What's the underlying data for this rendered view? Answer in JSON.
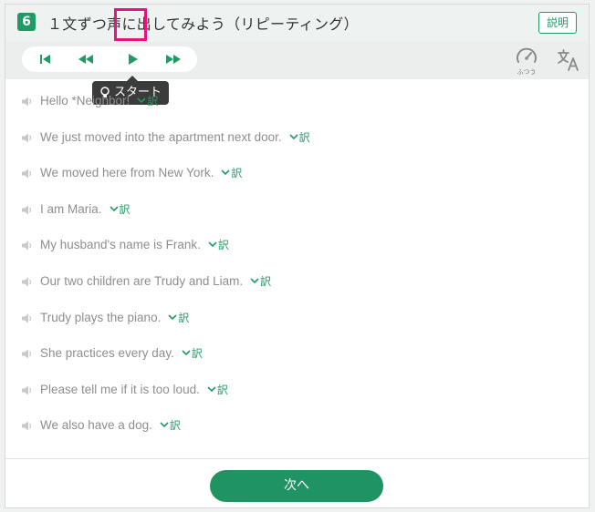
{
  "header": {
    "step_number": "6",
    "title": "１文ずつ声に出してみよう（リピーティング）",
    "explain_label": "説明"
  },
  "toolbar": {
    "speed_caption": "ふつう",
    "tooltip_label": "スタート"
  },
  "sentences": [
    {
      "text": "Hello *Neighbor!",
      "translate_label": "訳"
    },
    {
      "text": "We just moved into the apartment next door.",
      "translate_label": "訳"
    },
    {
      "text": "We moved here from New York.",
      "translate_label": "訳"
    },
    {
      "text": "I am Maria.",
      "translate_label": "訳"
    },
    {
      "text": "My husband's name is Frank.",
      "translate_label": "訳"
    },
    {
      "text": "Our two children are Trudy and Liam.",
      "translate_label": "訳"
    },
    {
      "text": "Trudy plays the piano.",
      "translate_label": "訳"
    },
    {
      "text": "She practices every day.",
      "translate_label": "訳"
    },
    {
      "text": "Please tell me if it is too loud.",
      "translate_label": "訳"
    },
    {
      "text": "We also have a dog.",
      "translate_label": "訳"
    }
  ],
  "footer": {
    "next_label": "次へ"
  },
  "colors": {
    "accent": "#229a64",
    "highlight": "#e6157e",
    "tooltip_bg": "#3b3b3b"
  },
  "icons": {
    "player": [
      "skip-to-start-icon",
      "rewind-icon",
      "play-icon",
      "fast-forward-icon"
    ],
    "speed": "speedometer-icon",
    "translate": "translate-icon",
    "tooltip": "lightbulb-icon",
    "sentence": "speaker-icon"
  }
}
